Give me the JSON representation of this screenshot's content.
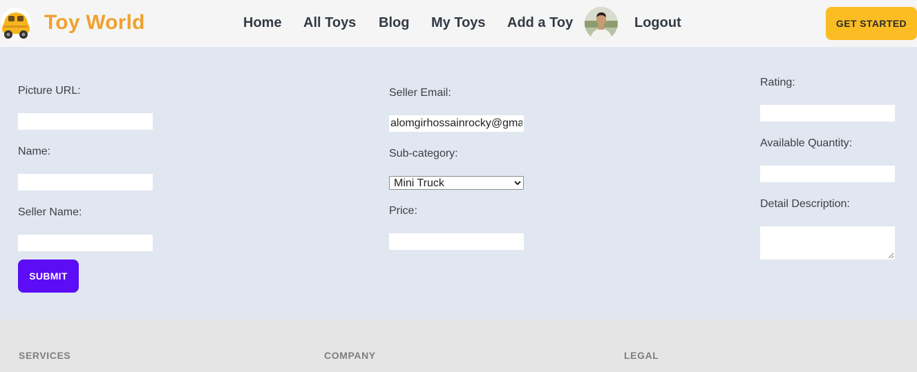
{
  "nav": {
    "brand": "Toy World",
    "links": [
      "Home",
      "All Toys",
      "Blog",
      "My Toys",
      "Add a Toy",
      "Logout"
    ],
    "cta": "GET STARTED",
    "logo_icon": "car-icon",
    "colors": {
      "brand": "#f0a12e",
      "cta": "#fbbd23"
    }
  },
  "form": {
    "picture_url_label": "Picture URL:",
    "name_label": "Name:",
    "seller_name_label": "Seller Name:",
    "seller_email_label": "Seller Email:",
    "seller_email_value": "alomgirhossainrocky@gmail",
    "subcategory_label": "Sub-category:",
    "subcategory_selected": "Mini Truck",
    "price_label": "Price:",
    "rating_label": "Rating:",
    "quantity_label": "Available Quantity:",
    "description_label": "Detail Description:",
    "submit_label": "SUBMIT",
    "colors": {
      "submit": "#5c0df5"
    }
  },
  "footer": {
    "services_title": "SERVICES",
    "company_title": "COMPANY",
    "legal_title": "LEGAL"
  }
}
